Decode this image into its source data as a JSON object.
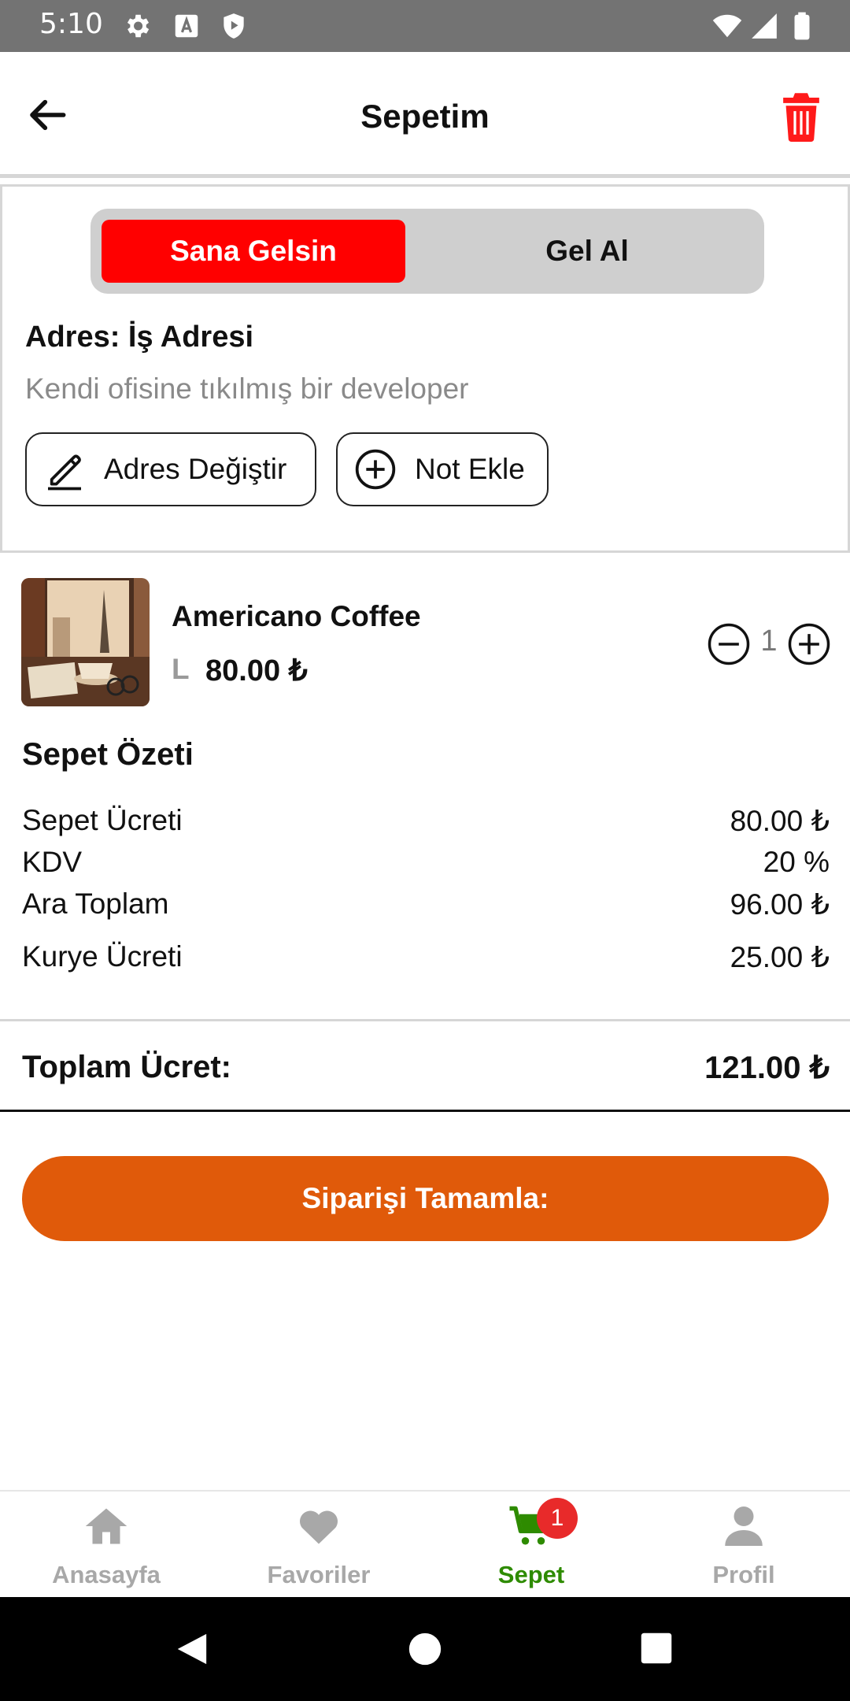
{
  "status_bar": {
    "time": "5:10"
  },
  "header": {
    "title": "Sepetim"
  },
  "delivery": {
    "options": [
      "Sana Gelsin",
      "Gel Al"
    ],
    "selected": "Sana Gelsin",
    "address_title": "Adres: İş Adresi",
    "address_description": "Kendi ofisine tıkılmış bir developer",
    "change_address_label": "Adres Değiştir",
    "add_note_label": "Not Ekle"
  },
  "cart": {
    "items": [
      {
        "name": "Americano Coffee",
        "size": "L",
        "price": "80.00 ₺",
        "quantity": "1"
      }
    ]
  },
  "summary": {
    "title": "Sepet Özeti",
    "rows": [
      {
        "label": "Sepet Ücreti",
        "value": "80.00 ₺"
      },
      {
        "label": "KDV",
        "value": "20 %"
      },
      {
        "label": "Ara Toplam",
        "value": "96.00 ₺"
      },
      {
        "label": "Kurye Ücreti",
        "value": "25.00 ₺"
      }
    ],
    "total_label": "Toplam Ücret:",
    "total_value": "121.00 ₺"
  },
  "checkout_label": "Siparişi Tamamla:",
  "bottom_nav": {
    "items": [
      {
        "label": "Anasayfa",
        "icon": "home-icon"
      },
      {
        "label": "Favoriler",
        "icon": "heart-icon"
      },
      {
        "label": "Sepet",
        "icon": "cart-icon"
      },
      {
        "label": "Profil",
        "icon": "person-icon"
      }
    ],
    "active": "Sepet",
    "cart_badge": "1"
  },
  "colors": {
    "accent_red": "#ff0000",
    "checkout_orange": "#e05a0a",
    "nav_active_green": "#2e8b00",
    "nav_inactive_gray": "#a8a8a8"
  }
}
